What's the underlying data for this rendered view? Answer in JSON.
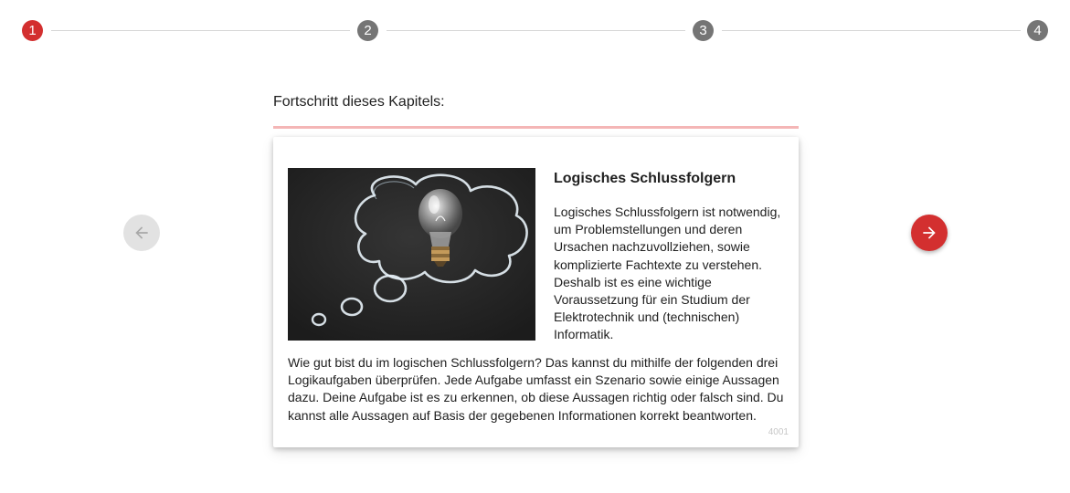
{
  "stepper": {
    "steps": [
      {
        "label": "1",
        "state": "active"
      },
      {
        "label": "2",
        "state": "inactive"
      },
      {
        "label": "3",
        "state": "inactive"
      },
      {
        "label": "4",
        "state": "inactive"
      }
    ]
  },
  "progress": {
    "label": "Fortschritt dieses Kapitels:",
    "value": 0
  },
  "card": {
    "image_icon": "lightbulb-thought-bubble-image",
    "title": "Logisches Schlussfolgern",
    "description": "Logisches Schlussfolgern ist notwendig, um Problemstellungen und deren Ursachen nachzuvollziehen, sowie komplizierte Fachtexte zu verstehen. Deshalb ist es eine wichtige Voraussetzung für ein Studium der Elektrotechnik und (technischen) Informatik.",
    "body": "Wie gut bist du im logischen Schlussfolgern? Das kannst du mithilfe der folgenden drei Logikaufgaben überprüfen. Jede Aufgabe umfasst ein Szenario sowie einige Aussagen dazu. Deine Aufgabe ist es zu erkennen, ob diese Aussagen richtig oder falsch sind. Du kannst alle Aussagen auf Basis der gegebenen Informationen korrekt beantworten.",
    "id": "4001"
  },
  "nav": {
    "prev_icon": "arrow-left-icon",
    "next_icon": "arrow-right-icon",
    "prev_enabled": false,
    "next_enabled": true
  },
  "colors": {
    "accent": "#d32f2f",
    "inactive_step": "#757575",
    "progress_track": "#f4b6b6"
  }
}
